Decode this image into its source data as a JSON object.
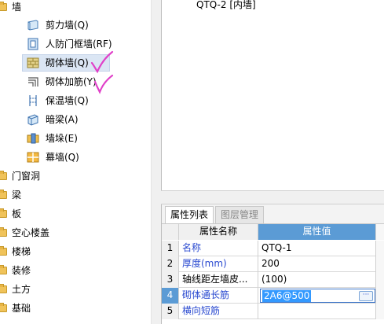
{
  "tree": {
    "top_label": "墙",
    "children": [
      {
        "label": "剪力墙(Q)",
        "icon": "shear-wall-icon"
      },
      {
        "label": "人防门框墙(RF)",
        "icon": "civil-defense-door-wall-icon"
      },
      {
        "label": "砌体墙(Q)",
        "icon": "masonry-wall-icon"
      },
      {
        "label": "砌体加筋(Y)",
        "icon": "masonry-reinforcement-icon"
      },
      {
        "label": "保温墙(Q)",
        "icon": "insulation-wall-icon"
      },
      {
        "label": "暗梁(A)",
        "icon": "hidden-beam-icon"
      },
      {
        "label": "墙垛(E)",
        "icon": "wall-pier-icon"
      },
      {
        "label": "幕墙(Q)",
        "icon": "curtain-wall-icon"
      }
    ],
    "categories": [
      "门窗洞",
      "梁",
      "板",
      "空心楼盖",
      "楼梯",
      "装修",
      "土方",
      "基础"
    ]
  },
  "view": {
    "title": "QTQ-2 [内墙]"
  },
  "props": {
    "tabs": [
      "属性列表",
      "图层管理"
    ],
    "headers": {
      "name": "属性名称",
      "value": "属性值"
    },
    "rows": [
      {
        "num": "1",
        "name": "名称",
        "value": "QTQ-1"
      },
      {
        "num": "2",
        "name": "厚度(mm)",
        "value": "200"
      },
      {
        "num": "3",
        "name": "轴线距左墙皮...",
        "value": "(100)"
      },
      {
        "num": "4",
        "name": "砌体通长筋",
        "value": "2A6@500"
      },
      {
        "num": "5",
        "name": "横向短筋",
        "value": ""
      }
    ],
    "editor_more": "···"
  },
  "colors": {
    "accent": "#5b9bd5",
    "selection": "#3399ff",
    "checkmark": "#e040c8",
    "link": "#2a4ad0"
  }
}
